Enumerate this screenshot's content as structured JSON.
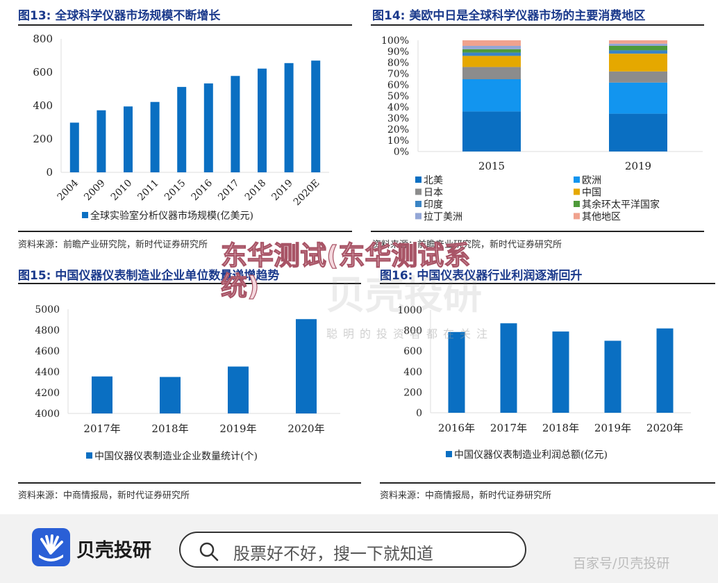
{
  "chart_data": [
    {
      "type": "bar",
      "title": "图13:  全球科学仪器市场规模不断增长",
      "categories": [
        "2004",
        "2009",
        "2010",
        "2011",
        "2015",
        "2016",
        "2017",
        "2018",
        "2019",
        "2020E"
      ],
      "series": [
        {
          "name": "全球实验室分析仪器市场规模(亿美元)",
          "values": [
            298,
            372,
            395,
            422,
            512,
            533,
            578,
            622,
            655,
            670
          ]
        }
      ],
      "ylim": [
        0,
        800
      ],
      "yticks": [
        "0",
        "200",
        "400",
        "600",
        "800"
      ],
      "legend": "bottom",
      "source": "资料来源：前瞻产业研究院，新时代证券研究所",
      "color": "#0a6fc2"
    },
    {
      "type": "stacked-bar",
      "title": "图14:  美欧中日是全球科学仪器市场的主要消费地区",
      "categories": [
        "2015",
        "2019"
      ],
      "series": [
        {
          "name": "北美",
          "values": [
            36,
            34
          ],
          "color": "#0a6fc2"
        },
        {
          "name": "欧洲",
          "values": [
            29,
            28
          ],
          "color": "#1295ef"
        },
        {
          "name": "日本",
          "values": [
            11,
            10
          ],
          "color": "#8c8c8c"
        },
        {
          "name": "中国",
          "values": [
            10,
            16
          ],
          "color": "#e5a800"
        },
        {
          "name": "印度",
          "values": [
            3,
            3
          ],
          "color": "#3a84c4"
        },
        {
          "name": "其余环太平洋国家",
          "values": [
            3,
            4
          ],
          "color": "#4e9a3a"
        },
        {
          "name": "拉丁美洲",
          "values": [
            3,
            2
          ],
          "color": "#93a6d6"
        },
        {
          "name": "其他地区",
          "values": [
            5,
            3
          ],
          "color": "#f0a28e"
        }
      ],
      "ylim": [
        0,
        100
      ],
      "yticks": [
        "0%",
        "10%",
        "20%",
        "30%",
        "40%",
        "50%",
        "60%",
        "70%",
        "80%",
        "90%",
        "100%"
      ],
      "legend": "bottom",
      "source": "资料来源：前瞻产业研究院，新时代证券研究所"
    },
    {
      "type": "bar",
      "title": "图15:  中国仪器仪表制造业企业单位数量递增趋势",
      "categories": [
        "2017年",
        "2018年",
        "2019年",
        "2020年"
      ],
      "series": [
        {
          "name": "中国仪器仪表制造业企业数量统计(个)",
          "values": [
            4355,
            4350,
            4450,
            4905
          ]
        }
      ],
      "ylim": [
        4000,
        5000
      ],
      "yticks": [
        "4000",
        "4200",
        "4400",
        "4600",
        "4800",
        "5000"
      ],
      "legend": "bottom",
      "source": "资料来源：中商情报局，新时代证券研究所",
      "color": "#0a6fc2"
    },
    {
      "type": "bar",
      "title": "图16:  中国仪表仪器行业利润逐渐回升",
      "categories": [
        "2016年",
        "2017年",
        "2018年",
        "2019年",
        "2020年"
      ],
      "series": [
        {
          "name": "中国仪器仪表制造业利润总额(亿元)",
          "values": [
            785,
            870,
            790,
            700,
            820
          ]
        }
      ],
      "ylim": [
        0,
        1000
      ],
      "yticks": [
        "0",
        "200",
        "400",
        "600",
        "800",
        "1000"
      ],
      "legend": "bottom",
      "source": "资料来源：中商情报局，新时代证券研究所",
      "color": "#0a6fc2"
    }
  ],
  "watermark": {
    "overlay": "东华测试(东华测试系统)",
    "brand": "贝壳投研",
    "slogan": "聪明的投资者都在关注"
  },
  "footer": {
    "brand": "贝壳投研",
    "search_placeholder": "股票好不好，搜一下就知道",
    "attribution": "百家号/贝壳投研",
    "brand_color": "#2a5fd6"
  }
}
